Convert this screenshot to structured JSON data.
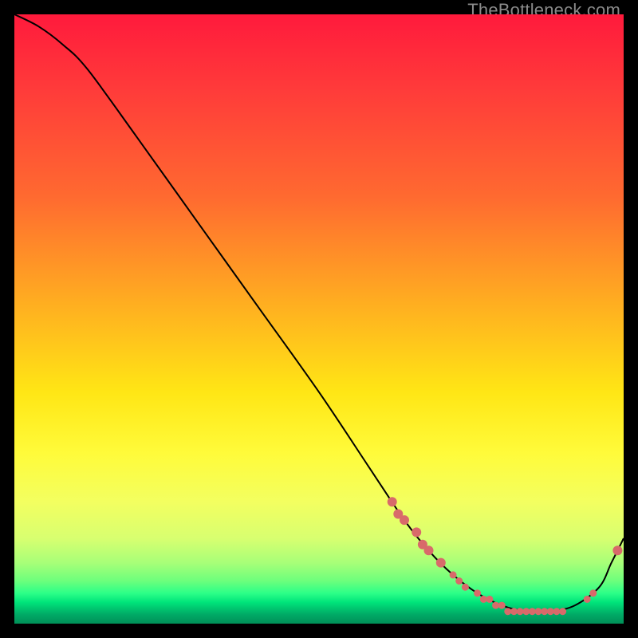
{
  "watermark": "TheBottleneck.com",
  "colors": {
    "frame_bg": "#000000",
    "curve_stroke": "#000000",
    "dot_fill": "#d86a6a"
  },
  "chart_data": {
    "type": "line",
    "title": "",
    "xlabel": "",
    "ylabel": "",
    "xlim": [
      0,
      100
    ],
    "ylim": [
      0,
      100
    ],
    "series": [
      {
        "name": "bottleneck-curve",
        "x": [
          0,
          4,
          8,
          12,
          20,
          30,
          40,
          50,
          58,
          64,
          68,
          72,
          76,
          80,
          84,
          88,
          92,
          96,
          98,
          100
        ],
        "y": [
          100,
          98,
          95,
          91,
          80,
          66,
          52,
          38,
          26,
          17,
          12,
          8,
          5,
          3,
          2,
          2,
          3,
          6,
          10,
          14
        ]
      }
    ],
    "markers": {
      "name": "highlighted-points",
      "x": [
        62,
        63,
        64,
        66,
        67,
        68,
        70,
        72,
        73,
        74,
        76,
        77,
        78,
        79,
        80,
        81,
        82,
        83,
        84,
        85,
        86,
        87,
        88,
        89,
        90,
        94,
        95,
        99
      ],
      "y": [
        20,
        18,
        17,
        15,
        13,
        12,
        10,
        8,
        7,
        6,
        5,
        4,
        4,
        3,
        3,
        2,
        2,
        2,
        2,
        2,
        2,
        2,
        2,
        2,
        2,
        4,
        5,
        12
      ]
    }
  }
}
